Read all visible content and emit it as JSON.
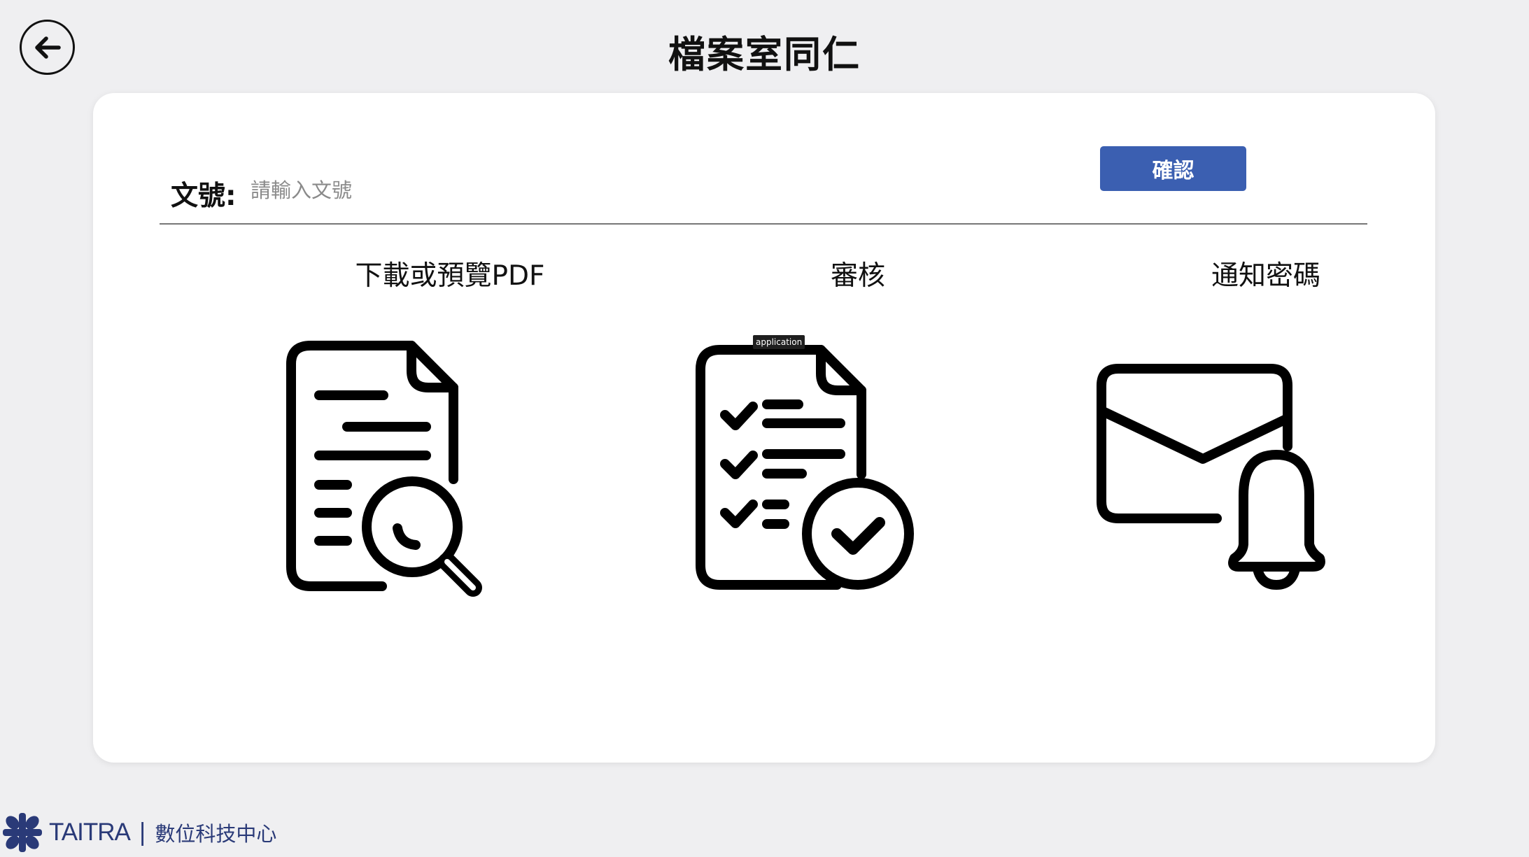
{
  "header": {
    "title": "檔案室同仁",
    "back_icon": "arrow-left-icon"
  },
  "form": {
    "label": "文號:",
    "placeholder": "請輸入文號",
    "value": "",
    "confirm_label": "確認"
  },
  "tiles": [
    {
      "label": "下載或預覽PDF",
      "icon": "document-search-icon"
    },
    {
      "label": "審核",
      "icon": "checklist-approve-icon"
    },
    {
      "label": "通知密碼",
      "icon": "mail-bell-icon"
    }
  ],
  "tooltip": {
    "text": "application"
  },
  "footer": {
    "brand": "TAITRA",
    "separator": "|",
    "department": "數位科技中心"
  },
  "colors": {
    "background": "#efeff1",
    "card": "#ffffff",
    "accent": "#3b5fb1",
    "brand": "#2a3a78"
  }
}
